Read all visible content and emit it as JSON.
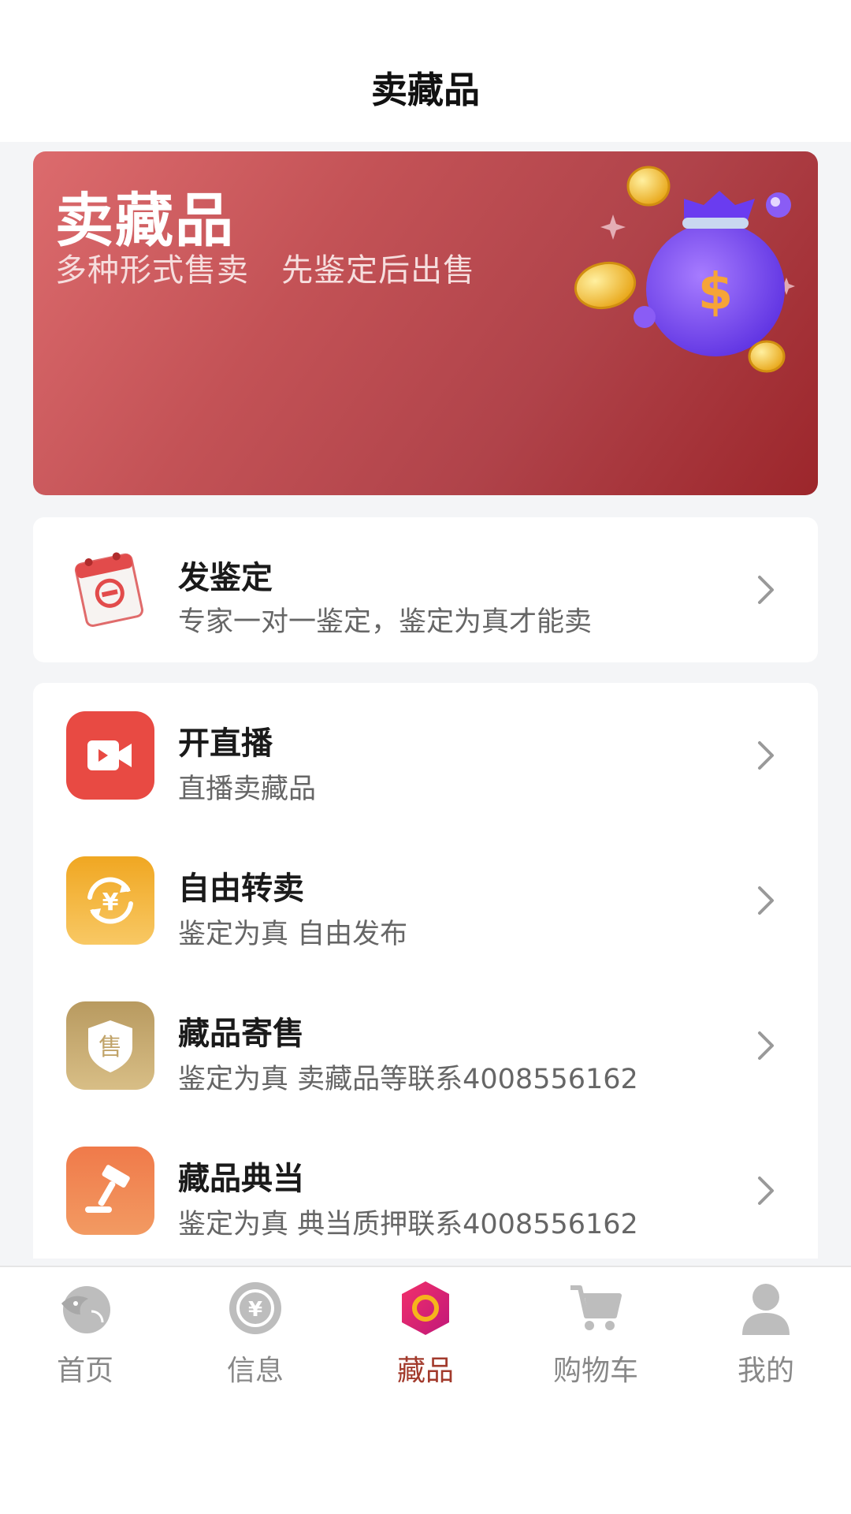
{
  "header": {
    "title": "卖藏品"
  },
  "banner": {
    "title": "卖藏品",
    "subtitle": "多种形式售卖   先鉴定后出售",
    "art_icon": "money-bag-with-coins"
  },
  "appraise": {
    "title": "发鉴定",
    "subtitle": "专家一对一鉴定，鉴定为真才能卖",
    "icon": "calendar-stamp-icon"
  },
  "services": [
    {
      "title": "开直播",
      "subtitle": "直播卖藏品",
      "icon": "video-camera-icon",
      "color": "#e84a43"
    },
    {
      "title": "自由转卖",
      "subtitle": "鉴定为真 自由发布",
      "icon": "yuan-exchange-icon",
      "color": "#f3b23a"
    },
    {
      "title": "藏品寄售",
      "subtitle": "鉴定为真 卖藏品等联系4008556162",
      "icon": "sale-shield-icon",
      "color": "#c4a572"
    },
    {
      "title": "藏品典当",
      "subtitle": "鉴定为真 典当质押联系4008556162",
      "icon": "gavel-icon",
      "color": "#ef7a4b"
    }
  ],
  "tabs": [
    {
      "label": "首页",
      "icon": "home-fish-icon",
      "active": false
    },
    {
      "label": "信息",
      "icon": "yuan-coin-icon",
      "active": false
    },
    {
      "label": "藏品",
      "icon": "hexagon-ring-icon",
      "active": true
    },
    {
      "label": "购物车",
      "icon": "cart-icon",
      "active": false
    },
    {
      "label": "我的",
      "icon": "user-icon",
      "active": false
    }
  ],
  "colors": {
    "accent": "#a23a2c",
    "banner_start": "#dc6b6d",
    "banner_end": "#9c262b"
  }
}
